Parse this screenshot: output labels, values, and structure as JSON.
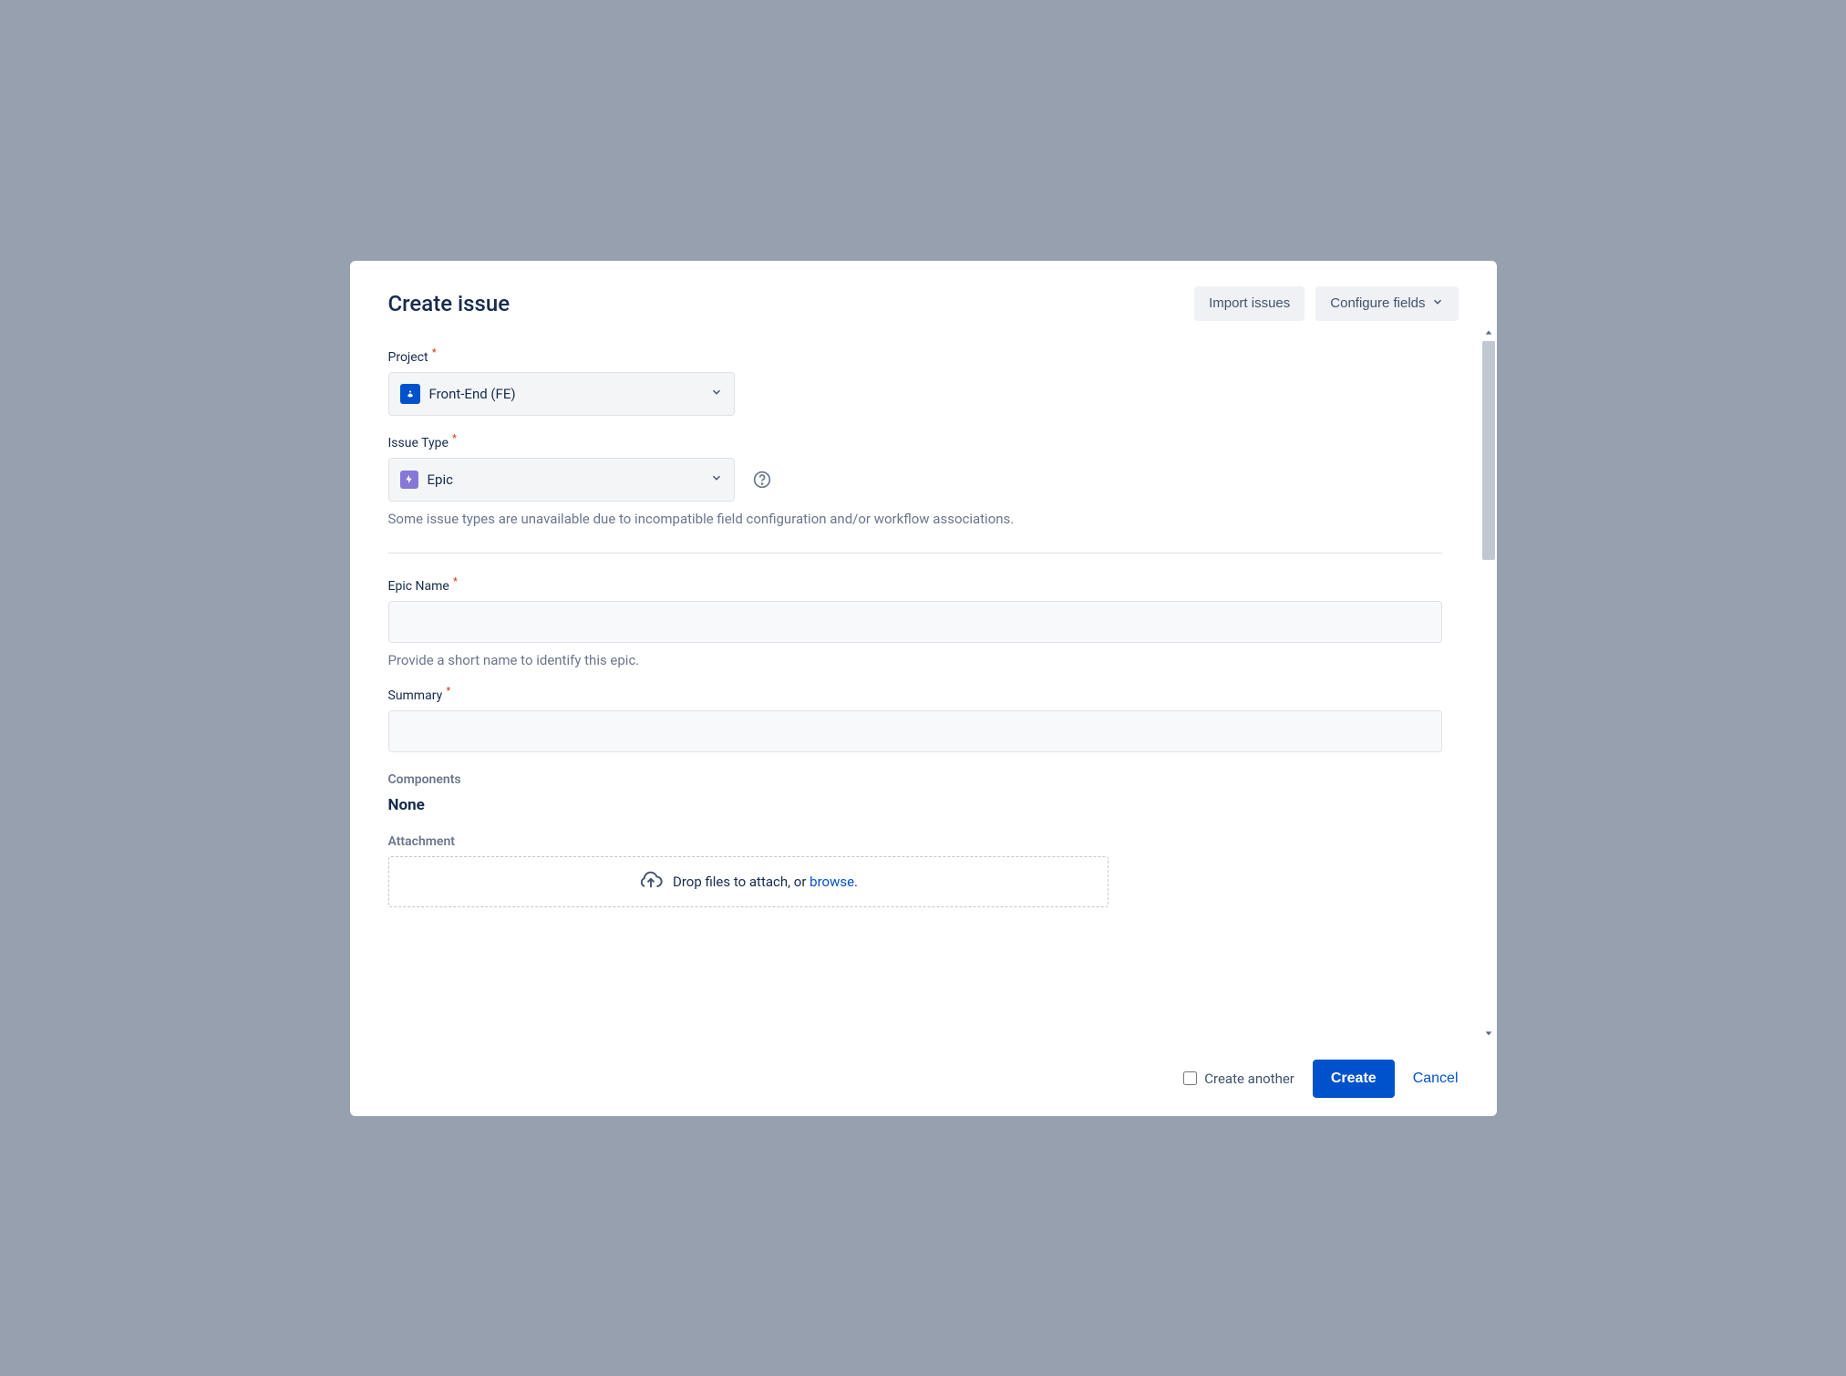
{
  "header": {
    "title": "Create issue",
    "import_label": "Import issues",
    "configure_label": "Configure fields"
  },
  "fields": {
    "project": {
      "label": "Project",
      "value": "Front-End (FE)"
    },
    "issue_type": {
      "label": "Issue Type",
      "value": "Epic",
      "hint": "Some issue types are unavailable due to incompatible field configuration and/or workflow associations."
    },
    "epic_name": {
      "label": "Epic Name",
      "value": "",
      "hint": "Provide a short name to identify this epic."
    },
    "summary": {
      "label": "Summary",
      "value": ""
    },
    "components": {
      "label": "Components",
      "value": "None"
    },
    "attachment": {
      "label": "Attachment",
      "drop_text": "Drop files to attach, or ",
      "browse_text": "browse",
      "period": "."
    }
  },
  "footer": {
    "create_another_label": "Create another",
    "create_label": "Create",
    "cancel_label": "Cancel"
  }
}
